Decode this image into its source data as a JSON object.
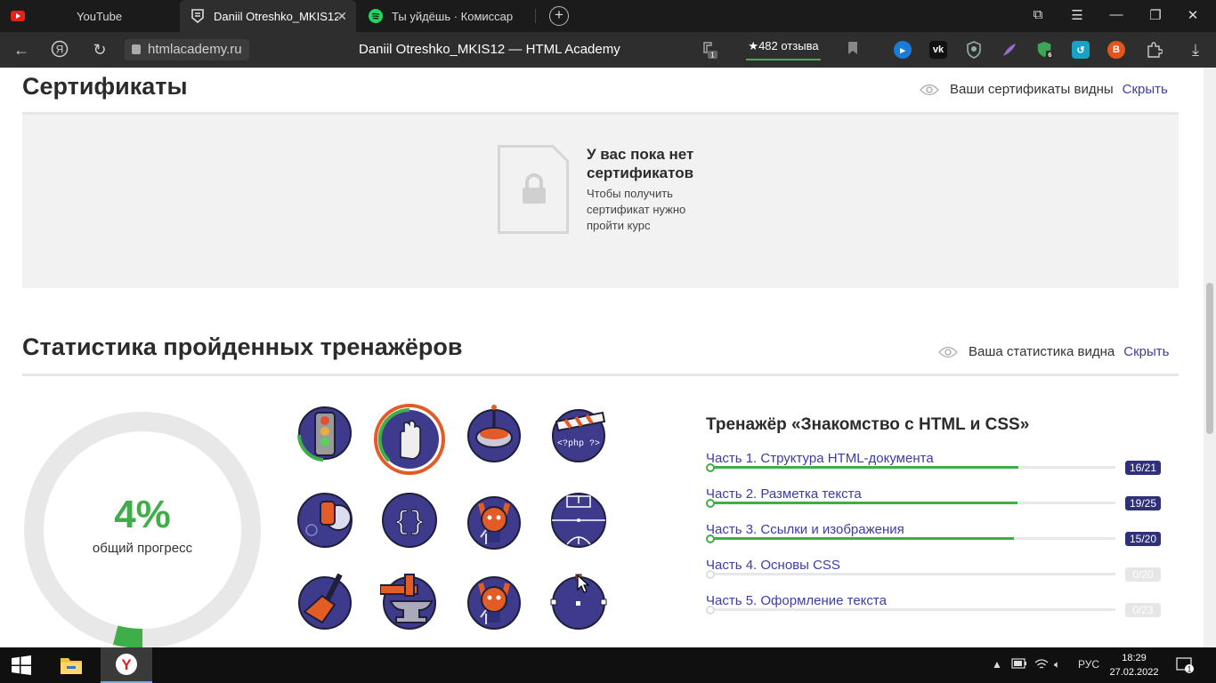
{
  "browser": {
    "tabs": [
      {
        "label": "YouTube",
        "icon": "youtube-icon"
      },
      {
        "label": "Daniil Otreshko_MKIS12",
        "icon": "htmlacademy-icon"
      },
      {
        "label": "Ты уйдёшь · Комиссар",
        "icon": "spotify-icon"
      }
    ],
    "url": "htmlacademy.ru",
    "page_title": "Daniil Otreshko_MKIS12 — HTML Academy",
    "reviews": "★482 отзыва",
    "extension_badges": {
      "tab_count": "1",
      "shield_count": "6"
    }
  },
  "certificates": {
    "title": "Сертификаты",
    "visibility": "Ваши сертификаты видны",
    "hide": "Скрыть",
    "empty_title": "У вас пока нет сертификатов",
    "empty_text": "Чтобы получить сертификат нужно пройти курс"
  },
  "stats": {
    "title": "Статистика пройденных тренажёров",
    "visibility": "Ваша статистика видна",
    "hide": "Скрыть",
    "progress_percent": 4,
    "progress_text": "4%",
    "progress_label": "общий прогресс",
    "trainer_title": "Тренажёр «Знакомство с HTML и CSS»",
    "parts": [
      {
        "label": "Часть 1. Структура HTML-документа",
        "done": 16,
        "total": 21,
        "count": "16/21"
      },
      {
        "label": "Часть 2. Разметка текста",
        "done": 19,
        "total": 25,
        "count": "19/25"
      },
      {
        "label": "Часть 3. Ссылки и изображения",
        "done": 15,
        "total": 20,
        "count": "15/20"
      },
      {
        "label": "Часть 4. Основы CSS",
        "done": 0,
        "total": 20,
        "count": "0/20"
      },
      {
        "label": "Часть 5. Оформление текста",
        "done": 0,
        "total": 23,
        "count": "0/23"
      }
    ]
  },
  "colors": {
    "accent_green": "#3fae49",
    "accent_blue": "#3c3ca8",
    "badge_navy": "#2f2f7a",
    "badge_purple": "#3e3a8c"
  },
  "taskbar": {
    "lang": "РУС",
    "time": "18:29",
    "date": "27.02.2022",
    "notifications": "1"
  }
}
